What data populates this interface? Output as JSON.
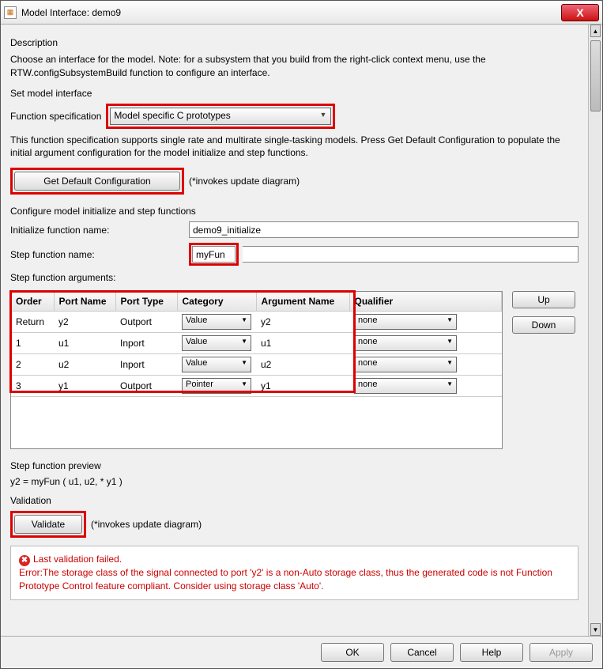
{
  "title": "Model Interface: demo9",
  "description_label": "Description",
  "description_text": "Choose an interface for the model. Note: for a subsystem that you build from the right-click context menu, use the RTW.configSubsystemBuild function to configure an interface.",
  "set_model_interface": "Set model interface",
  "func_spec_label": "Function specification",
  "func_spec_value": "Model specific C prototypes",
  "func_spec_note": "This function specification supports single rate and multirate single-tasking models.  Press Get Default Configuration to populate the initial argument configuration for the model initialize and step functions.",
  "get_default_btn": "Get Default Configuration",
  "invokes_note": "(*invokes update diagram)",
  "configure_label": "Configure model initialize and step functions",
  "init_fn_label": "Initialize function name:",
  "init_fn_value": "demo9_initialize",
  "step_fn_label": "Step function name:",
  "step_fn_value": "myFun",
  "args_label": "Step function arguments:",
  "table": {
    "headers": [
      "Order",
      "Port Name",
      "Port Type",
      "Category",
      "Argument Name",
      "Qualifier"
    ],
    "rows": [
      {
        "order": "Return",
        "port": "y2",
        "ptype": "Outport",
        "cat": "Value",
        "arg": "y2",
        "qual": "none"
      },
      {
        "order": "1",
        "port": "u1",
        "ptype": "Inport",
        "cat": "Value",
        "arg": "u1",
        "qual": "none"
      },
      {
        "order": "2",
        "port": "u2",
        "ptype": "Inport",
        "cat": "Value",
        "arg": "u2",
        "qual": "none"
      },
      {
        "order": "3",
        "port": "y1",
        "ptype": "Outport",
        "cat": "Pointer",
        "arg": "y1",
        "qual": "none"
      }
    ]
  },
  "up_btn": "Up",
  "down_btn": "Down",
  "preview_label": "Step function preview",
  "preview_text": "y2 = myFun ( u1, u2, * y1 )",
  "validation_label": "Validation",
  "validate_btn": "Validate",
  "err_title": "Last validation failed.",
  "err_text": "Error:The storage class of the signal connected to port 'y2' is a non-Auto storage class, thus the generated code is not Function Prototype Control feature compliant. Consider using storage class 'Auto'.",
  "ok": "OK",
  "cancel": "Cancel",
  "help": "Help",
  "apply": "Apply"
}
